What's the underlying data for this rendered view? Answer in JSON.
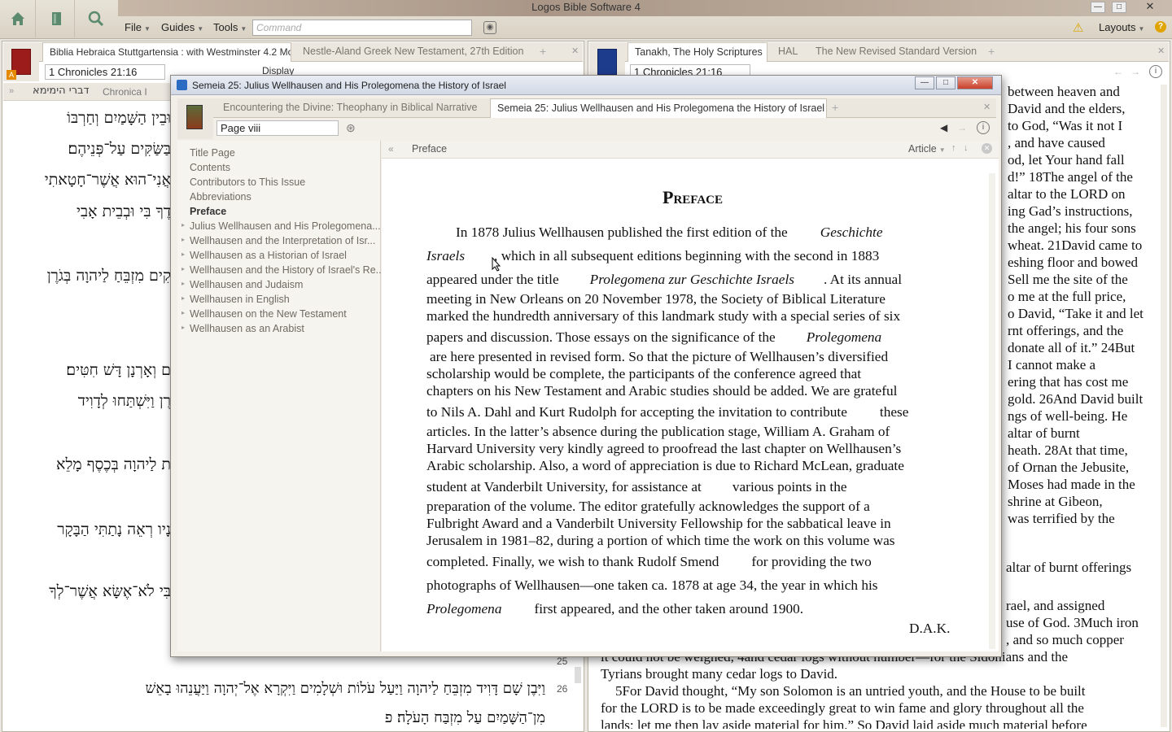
{
  "app": {
    "title": "Logos Bible Software 4",
    "menus": [
      "File",
      "Guides",
      "Tools"
    ],
    "command_placeholder": "Command",
    "layouts": "Layouts"
  },
  "left_panel": {
    "tabs": [
      "Biblia Hebraica Stuttgartensia : with Westminster 4.2 Morphology",
      "Nestle-Aland Greek New Testament, 27th Edition"
    ],
    "reference": "1 Chronicles 21:16",
    "display": "Display",
    "crumb_hebrew": "דברי הימימא",
    "crumb_latin": "Chronica I",
    "hebrew_lines": [
      "וּבֵין הַשָּׁמַיִם וְחַרְבּוֹ",
      "בַּשַּׂקִּים עַל־פְּנֵיהֶם׃",
      "אֲנִי־הוּא אֲשֶׁר־חָטָאתִי",
      "דֶךָ בִּי וּבְבֵית אָבִי",
      "קִים מִזְבֵּחַ לַיהוָה בְּגֹרֶן",
      "ם וְאָרְנָן דָּשׁ חִטִּים׃",
      "רֶן וַיִּשְׁתַּחוּ לְדָוִיד",
      "ת לַיהוָה בְּכֶסֶף מָלֵא",
      "נָיו רְאֵה נָתַתִּי הַבָּקָר",
      "בִּי לֹא־אֶשָּׂא אֲשֶׁר־לְךָ"
    ],
    "verse_25": "25",
    "verse_26": "26",
    "verse_26_line1": "וַיִּבֶן שָׁם דָּוִיד מִזְבֵּחַ לַיהוָה וַיַּעַל עֹלוֹת וּשְׁלָמִים וַיִּקְרָא אֶל־יְהוָה וַיַּעֲנֵהוּ בָאֵשׁ",
    "verse_26_line2": "מִן־הַשָּׁמַיִם עַל מִזְבַּח הָעֹלָה׃ פ"
  },
  "right_panel": {
    "tabs": [
      "Tanakh, The Holy Scriptures",
      "HAL",
      "The New Revised Standard Version"
    ],
    "reference": "1 Chronicles 21:16",
    "lines": [
      "between heaven and",
      "David and the elders,",
      "to God, “Was it not I",
      ", and have caused",
      "od, let Your hand fall",
      "d!” 18The angel of the",
      "altar to the LORD on",
      "ing Gad’s instructions,",
      "the angel; his four sons",
      "wheat. 21David came to",
      "eshing floor and bowed",
      "Sell me the site of the",
      "o me at the full price,",
      "o David, “Take it and let",
      "rnt offerings, and the",
      "donate all of it.” 24But",
      "I cannot make a",
      "ering that has cost me",
      "gold. 26And David built",
      "ngs of well-being. He",
      "altar of burnt",
      "heath. 28At that time,",
      "of Ornan the Jebusite,",
      "Moses had made in the",
      "shrine at Gibeon,",
      "was terrified by the"
    ],
    "line_altar": "altar of burnt offerings",
    "line_rael": "rael, and assigned",
    "line_use": "use of God. 3Much iron",
    "line_copper": ", and so much copper",
    "line_sidonians": "it could not be weighed, 4and cedar logs without number—for the Sidonians and the",
    "line_tyrians": "Tyrians brought many cedar logs to David.",
    "line_5": "5For David thought, “My son Solomon is an untried youth, and the House to be built",
    "line_6": "for the LORD is to be made exceedingly great to win fame and glory throughout all the",
    "line_7": "lands; let me then lay aside material for him.” So David laid aside much material before"
  },
  "floating_window": {
    "title": "Semeia 25: Julius Wellhausen and His Prolegomena the History of Israel",
    "tabs": [
      "Encountering the Divine: Theophany in Biblical Narrative",
      "Semeia 25: Julius Wellhausen and His Prolegomena the History of Israel"
    ],
    "page_ref": "Page viii",
    "section_crumb": "Preface",
    "article_label": "Article",
    "toc": [
      {
        "label": "Title Page",
        "expandable": false,
        "bold": false
      },
      {
        "label": "Contents",
        "expandable": false,
        "bold": false
      },
      {
        "label": "Contributors to This Issue",
        "expandable": false,
        "bold": false
      },
      {
        "label": "Abbreviations",
        "expandable": false,
        "bold": false
      },
      {
        "label": "Preface",
        "expandable": false,
        "bold": true
      },
      {
        "label": "Julius Wellhausen and His Prolegomena...",
        "expandable": true,
        "bold": false
      },
      {
        "label": "Wellhausen and the Interpretation of Isr...",
        "expandable": true,
        "bold": false
      },
      {
        "label": "Wellhausen as a Historian of Israel",
        "expandable": true,
        "bold": false
      },
      {
        "label": "Wellhausen and the History of Israel's Re...",
        "expandable": true,
        "bold": false
      },
      {
        "label": "Wellhausen and Judaism",
        "expandable": true,
        "bold": false
      },
      {
        "label": "Wellhausen in English",
        "expandable": true,
        "bold": false
      },
      {
        "label": "Wellhausen on the New Testament",
        "expandable": true,
        "bold": false
      },
      {
        "label": "Wellhausen as an Arabist",
        "expandable": true,
        "bold": false
      }
    ],
    "heading": "Preface",
    "paragraph": {
      "l1a": "In 1878 Julius Wellhausen published the first edition of the",
      "l1b": "Geschichte",
      "l2a": "Israels",
      "l2b": ", which in all subsequent editions beginning with the second in 1883",
      "l3a": "appeared under the title",
      "l3b": "Prolegomena zur Geschichte Israels",
      "l3c": ". At its annual",
      "l4": "meeting in New Orleans on 20 November 1978, the Society of Biblical Literature",
      "l5": "marked the hundredth anniversary of this landmark study with a special series of six",
      "l6a": "papers and discussion. Those essays on the significance of the",
      "l6b": "Prolegomena",
      "l7": "are here presented in revised form. So that the picture of Wellhausen’s diversified",
      "l8": "scholarship would be complete, the participants of the conference agreed that",
      "l9": "chapters on his New Testament and Arabic studies should be added. We are grateful",
      "l10a": "to Nils A. Dahl and Kurt Rudolph for accepting the invitation to contribute",
      "l10b": "these",
      "l11": "articles. In the latter’s absence during the publication stage, William A. Graham of",
      "l12": "Harvard University very kindly agreed to proofread the last chapter on Wellhausen’s",
      "l13": "Arabic scholarship. Also, a word of appreciation is due to Richard McLean, graduate",
      "l14a": "student at Vanderbilt University, for assistance at",
      "l14b": "various points in the",
      "l15": "preparation of the volume. The editor gratefully acknowledges the support of a",
      "l16": "Fulbright Award and a Vanderbilt University Fellowship for the sabbatical leave in",
      "l17": "Jerusalem in 1981–82, during a portion of which time the work on this volume was",
      "l18a": "completed. Finally, we wish to thank Rudolf Smend",
      "l18b": "for providing the two",
      "l19": "photographs of Wellhausen—one taken ca. 1878 at age 34, the year in which his",
      "l20a": "Prolegomena",
      "l20b": "first appeared, and the other taken around 1900.",
      "signature": "D.A.K."
    }
  }
}
